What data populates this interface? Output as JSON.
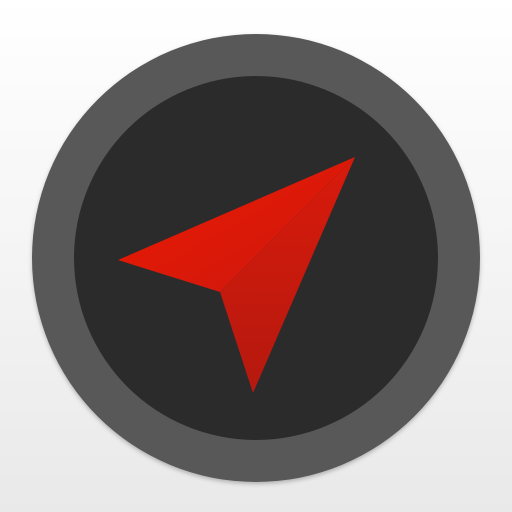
{
  "app_icon": {
    "icon": "navigation-arrow-icon",
    "colors": {
      "background_top": "#ffffff",
      "background_bottom": "#e9e9e9",
      "outer_ring": "#595959",
      "inner_disc": "#2b2b2b",
      "arrow_light": "#f01a00",
      "arrow_mid": "#d91a0b",
      "arrow_dark": "#b5190f"
    }
  }
}
